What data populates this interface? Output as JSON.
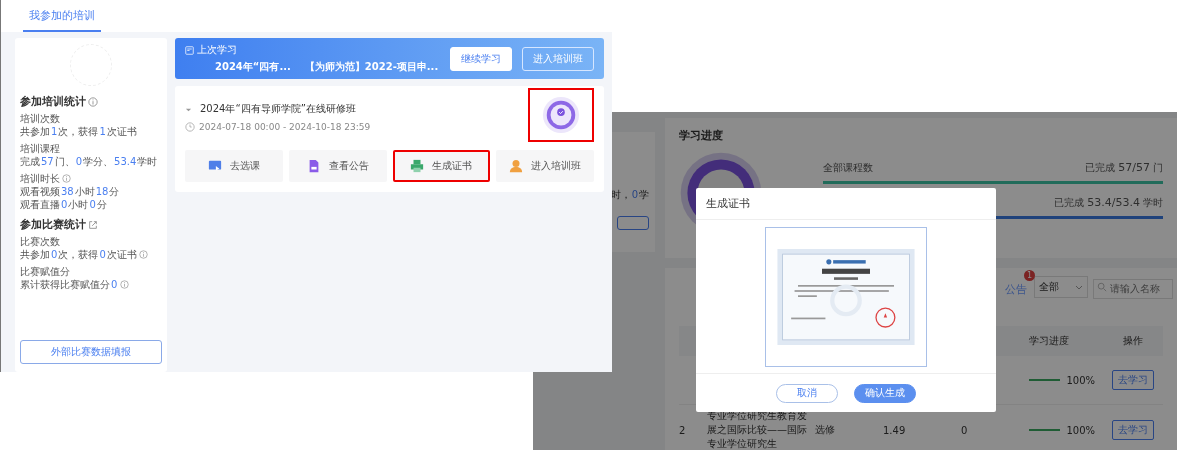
{
  "left_window": {
    "tabs": [
      {
        "label": "我参加的培训",
        "selected": true
      }
    ],
    "sidebar": {
      "sections": [
        {
          "title": "参加培训统计",
          "groups": [
            {
              "label": "培训次数",
              "label_info": false,
              "lines": [
                {
                  "parts": [
                    "共参加",
                    "1",
                    "次，获得",
                    "1",
                    "次证书"
                  ],
                  "info": false
                }
              ]
            },
            {
              "label": "培训课程",
              "label_info": false,
              "lines": [
                {
                  "parts": [
                    "完成",
                    "57",
                    "门、",
                    "0",
                    "学分、",
                    "53.4",
                    "学时"
                  ],
                  "info": false
                }
              ]
            },
            {
              "label": "培训时长",
              "label_info": true,
              "lines": [
                {
                  "parts": [
                    "观看视频",
                    "38",
                    "小时",
                    "18",
                    "分"
                  ],
                  "info": false
                },
                {
                  "parts": [
                    "观看直播",
                    "0",
                    "小时",
                    "0",
                    "分"
                  ],
                  "info": false
                }
              ]
            }
          ]
        },
        {
          "title": "参加比赛统计",
          "groups": [
            {
              "label": "比赛次数",
              "label_info": false,
              "lines": [
                {
                  "parts": [
                    "共参加",
                    "0",
                    "次，获得",
                    "0",
                    "次证书"
                  ],
                  "info": true
                }
              ]
            },
            {
              "label": "比赛赋值分",
              "label_info": false,
              "lines": [
                {
                  "parts": [
                    "累计获得比赛赋值分",
                    "0"
                  ],
                  "info": true
                }
              ]
            }
          ]
        }
      ],
      "button": "外部比赛数据填报"
    },
    "last_study": {
      "label": "上次学习",
      "items": [
        "2024年“四有...",
        "【为师为范】2022-项目申..."
      ],
      "buttons": [
        {
          "label": "继续学习",
          "kind": "primary"
        },
        {
          "label": "进入培训班",
          "kind": "outline"
        }
      ]
    },
    "course": {
      "title": "2024年“四有导师学院”在线研修班",
      "dates": "2024-07-18 00:00 - 2024-10-18 23:59",
      "badge": {
        "highlighted": true
      },
      "actions": [
        {
          "label": "去选课",
          "highlighted": false
        },
        {
          "label": "查看公告",
          "highlighted": false
        },
        {
          "label": "生成证书",
          "highlighted": true
        },
        {
          "label": "进入培训班",
          "highlighted": false
        }
      ]
    }
  },
  "right_window": {
    "side_card": {
      "parts": [
        "时，",
        "0",
        "学"
      ]
    },
    "progress": {
      "title": "学习进度",
      "rows": [
        {
          "label": "全部课程数",
          "parts": [
            "已完成",
            "57/57",
            "门"
          ],
          "level": 1
        },
        {
          "parts": [
            "已完成",
            "53.4/53.4",
            "学时"
          ],
          "level": 1
        }
      ]
    },
    "filters": {
      "announcement": "公告",
      "badge": "1",
      "select": "全部",
      "search_placeholder": "请输入名称"
    },
    "table": {
      "columns": [
        "学习进度",
        "操作"
      ],
      "rows": [
        {
          "level": 1,
          "reading": "100%",
          "action": "去学习"
        },
        {
          "index": "2",
          "title": "专业学位研究生教育发展之国际比较——国际专业学位研究生",
          "type": "选修",
          "credits": "1.49",
          "column_5": "0",
          "level": 1,
          "reading": "100%",
          "action": "去学习"
        }
      ]
    },
    "modal": {
      "title": "生成证书",
      "buttons": [
        {
          "label": "取消",
          "kind": "secondary"
        },
        {
          "label": "确认生成",
          "kind": "primary"
        }
      ]
    }
  }
}
